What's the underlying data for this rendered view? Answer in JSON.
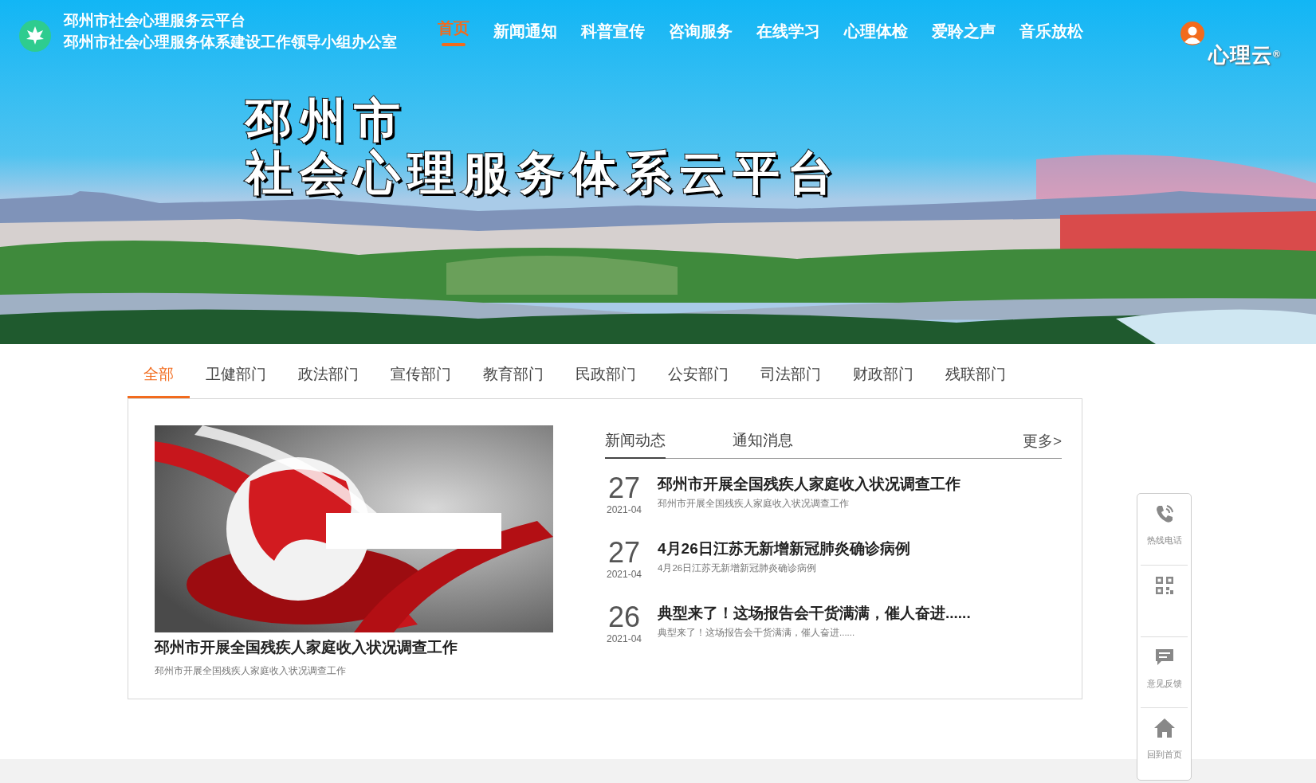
{
  "header": {
    "site_title": "邳州市社会心理服务云平台",
    "site_subtitle": "邳州市社会心理服务体系建设工作领导小组办公室",
    "nav": [
      {
        "label": "首页",
        "selected": true
      },
      {
        "label": "新闻通知",
        "selected": false
      },
      {
        "label": "科普宣传",
        "selected": false
      },
      {
        "label": "咨询服务",
        "selected": false
      },
      {
        "label": "在线学习",
        "selected": false
      },
      {
        "label": "心理体检",
        "selected": false
      },
      {
        "label": "爱聆之声",
        "selected": false
      },
      {
        "label": "音乐放松",
        "selected": false
      }
    ],
    "brand": "心理云$^{®}$"
  },
  "banner": {
    "title_lines": [
      "邳州市",
      "社会心理服务体系云平台"
    ]
  },
  "departments": [
    {
      "label": "全部",
      "selected": true
    },
    {
      "label": "卫健部门",
      "selected": false
    },
    {
      "label": "政法部门",
      "selected": false
    },
    {
      "label": "宣传部门",
      "selected": false
    },
    {
      "label": "教育部门",
      "selected": false
    },
    {
      "label": "民政部门",
      "selected": false
    },
    {
      "label": "公安部门",
      "selected": false
    },
    {
      "label": "司法部门",
      "selected": false
    },
    {
      "label": "财政部门",
      "selected": false
    },
    {
      "label": "残联部门",
      "selected": false
    }
  ],
  "news": {
    "feature": {
      "title": "邳州市开展全国残疾人家庭收入状况调查工作",
      "summary": "邳州市开展全国残疾人家庭收入状况调查工作"
    },
    "tabs": [
      {
        "label": "新闻动态",
        "selected": true
      },
      {
        "label": "通知消息",
        "selected": false
      }
    ],
    "more": "更多>",
    "items": [
      {
        "day": "27",
        "month": "2021-04",
        "title": "邳州市开展全国残疾人家庭收入状况调查工作",
        "summary": "邳州市开展全国残疾人家庭收入状况调查工作"
      },
      {
        "day": "27",
        "month": "2021-04",
        "title": "4月26日江苏无新增新冠肺炎确诊病例",
        "summary": "4月26日江苏无新增新冠肺炎确诊病例"
      },
      {
        "day": "26",
        "month": "2021-04",
        "title": "典型来了！这场报告会干货满满，催人奋进......",
        "summary": "典型来了！这场报告会干货满满，催人奋进......"
      }
    ]
  },
  "sidebar": [
    {
      "kind": "phone",
      "label": "热线电话"
    },
    {
      "kind": "qrcode"
    },
    {
      "kind": "feedback",
      "label": "意见反馈"
    },
    {
      "kind": "home",
      "label": "回到首页"
    }
  ]
}
